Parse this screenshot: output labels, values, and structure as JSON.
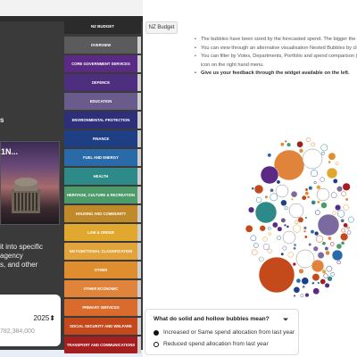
{
  "left_panel": {
    "heading": "s",
    "photo_caption": "1N...",
    "description_lines": [
      "it into specific",
      "agency",
      "s, and other"
    ],
    "year": "2025",
    "amount": "782,384,000"
  },
  "category_menu": {
    "header": "NZ BUDGET",
    "items": [
      {
        "label": "OVERVIEW",
        "color": "#5b5b5b"
      },
      {
        "label": "CORE GOVERNMENT SERVICES",
        "color": "#5a2a84"
      },
      {
        "label": "DEFENCE",
        "color": "#4e2e7e"
      },
      {
        "label": "EDUCATION",
        "color": "#6a5b8d"
      },
      {
        "label": "ENVIRONMENTAL PROTECTION",
        "color": "#2d2f7a"
      },
      {
        "label": "FINANCE",
        "color": "#1f3f85"
      },
      {
        "label": "FUEL AND ENERGY",
        "color": "#2a6aa8"
      },
      {
        "label": "HEALTH",
        "color": "#2d8a88"
      },
      {
        "label": "HERITAGE, CULTURE & RECREATION",
        "color": "#4d9a6b"
      },
      {
        "label": "HOUSING AND COMMUNITY",
        "color": "#c08a2a"
      },
      {
        "label": "LAW & ORDER",
        "color": "#e0a82e"
      },
      {
        "label": "NO FUNCTIONAL CLASSIFICATION",
        "color": "#e2a33a"
      },
      {
        "label": "OTHER",
        "color": "#de8e2e"
      },
      {
        "label": "OTHER ECONOMIC",
        "color": "#e0843c"
      },
      {
        "label": "PRIMARY SERVICES",
        "color": "#d96b2c"
      },
      {
        "label": "SOCIAL SECURITY AND WELFARE",
        "color": "#c44a1c"
      },
      {
        "label": "TRANSPORT AND COMMUNICATIONS",
        "color": "#a41e1e"
      }
    ]
  },
  "tab": {
    "label": "NZ Budget"
  },
  "info_lines": [
    {
      "text": "The bubbles have been sized by the forecasted spend. The bigger the bubble",
      "bold": false,
      "cont": false
    },
    {
      "text": "You can view through an alternative visualisation Nested Bubbles by clicking",
      "bold": false,
      "cont": false
    },
    {
      "text": "You can filter by Votes, Departments, Portfolio and spend comparison (Increa",
      "bold": false,
      "cont": false
    },
    {
      "text": "icon on the right hand menu.",
      "bold": false,
      "cont": true
    },
    {
      "text": "Give us your feedback through the widget available on the left.",
      "bold": true,
      "cont": false
    }
  ],
  "legend": {
    "question": "What do solid and hollow bubbles mean?",
    "increased": "Increased or Same spend allocation from last year",
    "reduced": "Reduced spend allocation from last year"
  },
  "colors": {
    "panel_bg": "#3a3a3a",
    "accent_orange": "#e0843c",
    "accent_red": "#c44a1c",
    "accent_teal": "#2d8a88",
    "accent_purple": "#7a6aa0"
  }
}
